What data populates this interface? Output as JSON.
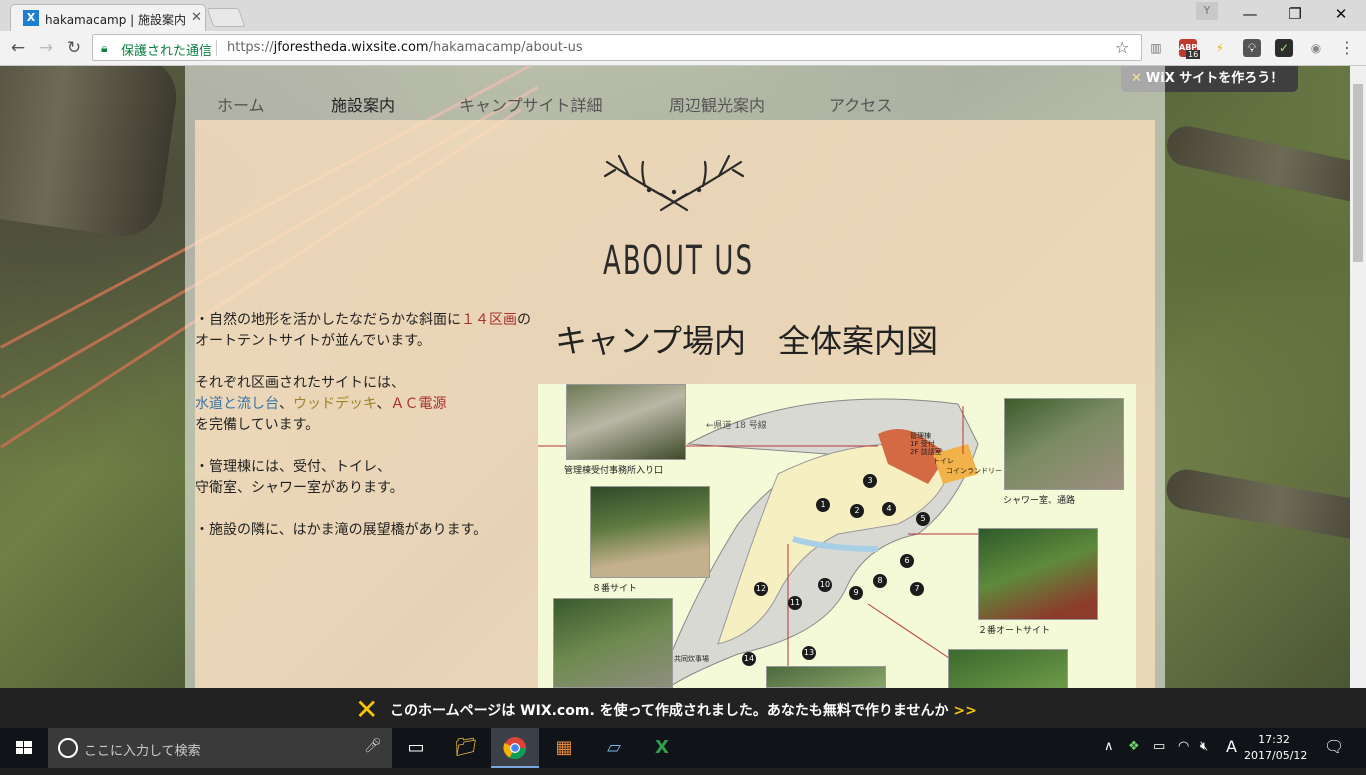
{
  "browser": {
    "tab_title": "hakamacamp | 施設案内",
    "tab_close": "✕",
    "profile_label": "Y",
    "window_controls": {
      "minimize": "—",
      "restore": "❐",
      "close": "✕"
    },
    "secure_label": "保護された通信",
    "url_scheme": "https://",
    "url_host": "jforestheda.wixsite.com",
    "url_path": "/hakamacamp/about-us",
    "abp_count": "16"
  },
  "site": {
    "wix_cta": "WiX サイトを作ろう！",
    "nav": [
      "ホーム",
      "施設案内",
      "キャンプサイト詳細",
      "周辺観光案内",
      "アクセス"
    ],
    "active_nav": "施設案内",
    "about_heading": "ABOUT US",
    "map_heading": "キャンプ場内　全体案内図",
    "description": {
      "p1_a": "・自然の地形を活かしたなだらかな斜面に",
      "p1_red": "１４区画",
      "p1_b": "の",
      "p1_c": "オートテントサイトが並んでいます。",
      "p2_a": "それぞれ区画されたサイトには、",
      "p2_water": "水道と流し台",
      "p2_sep1": "、",
      "p2_deck": "ウッドデッキ",
      "p2_sep2": "、",
      "p2_ac": "ＡＣ電源",
      "p2_b": "を完備しています。",
      "p3_a": "・管理棟には、受付、トイレ、",
      "p3_b": "守衛室、シャワー室があります。",
      "p4": "・施設の隣に、はかま滝の展望橋があります。"
    },
    "map": {
      "captions": {
        "office": "管理棟受付事務所入り口",
        "site8": "８番サイト",
        "shower": "シャワー室、通路",
        "site2": "２番オートサイト",
        "road": "←県道 18 号線",
        "kanri": "管理棟",
        "kanri_sub1": "1F 受付",
        "kanri_sub2": "2F 談話室",
        "toilet": "トイレ",
        "laundry": "コインランドリー",
        "kitchen": "共同炊事場"
      },
      "sites": [
        "1",
        "2",
        "3",
        "4",
        "5",
        "6",
        "7",
        "8",
        "9",
        "10",
        "11",
        "12",
        "13",
        "14"
      ]
    },
    "footer_message": "このホームページは WIX.com. を使って作成されました。あなたも無料で作りませんか",
    "footer_arrow": ">>"
  },
  "taskbar": {
    "search_placeholder": "ここに入力して検索",
    "ime": "A",
    "time": "17:32",
    "date": "2017/05/12"
  }
}
